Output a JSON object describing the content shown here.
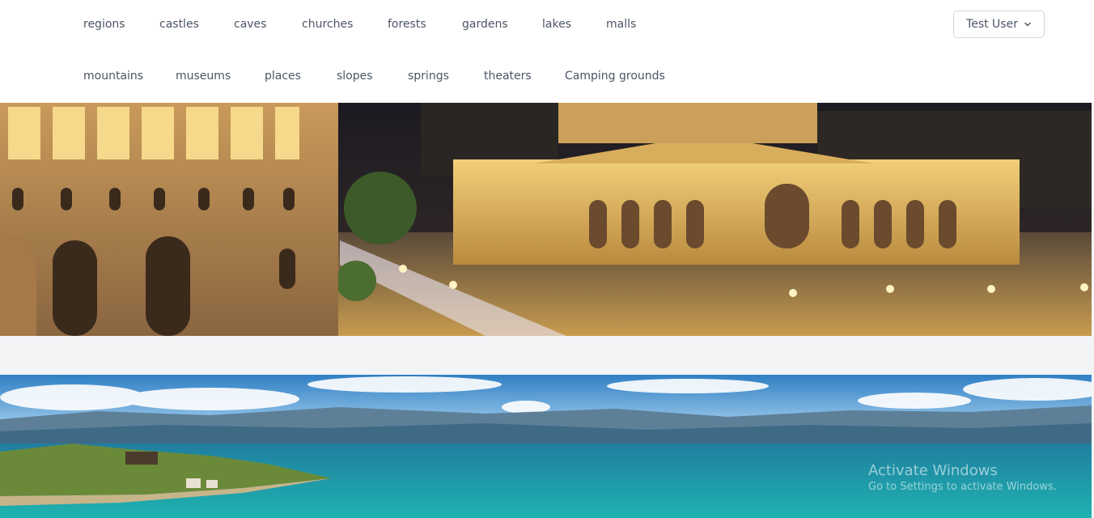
{
  "nav": {
    "row1": [
      "regions",
      "castles",
      "caves",
      "churches",
      "forests",
      "gardens",
      "lakes",
      "malls"
    ],
    "row2": [
      "mountains",
      "museums",
      "places",
      "slopes",
      "springs",
      "theaters",
      "Camping grounds"
    ]
  },
  "user_menu": {
    "label": "Test User",
    "icon": "chevron-down-icon"
  },
  "banners": [
    {
      "name": "yerevan-republic-square-night-photo"
    },
    {
      "name": "lake-sevan-peninsula-photo"
    }
  ],
  "watermark": {
    "line1": "Activate Windows",
    "line2": "Go to Settings to activate Windows."
  }
}
